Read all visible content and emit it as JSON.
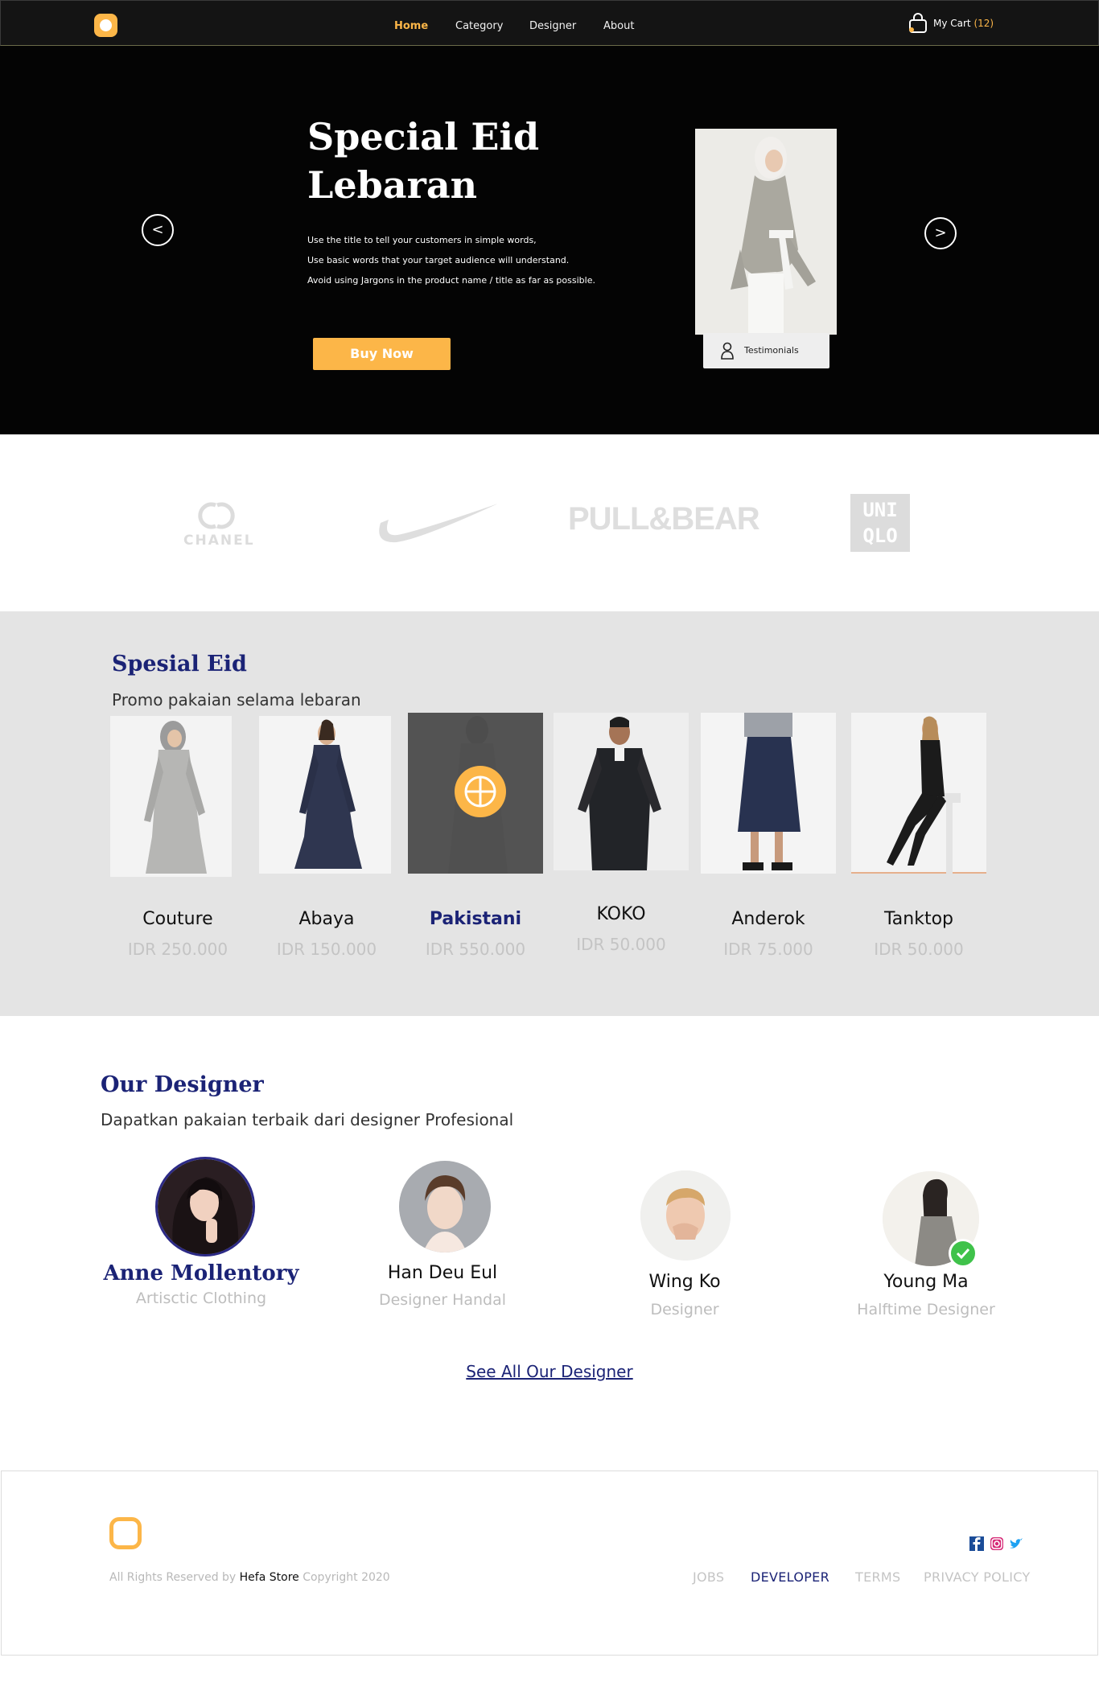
{
  "header": {
    "nav": [
      {
        "label": "Home",
        "active": true
      },
      {
        "label": "Category",
        "active": false
      },
      {
        "label": "Designer",
        "active": false
      },
      {
        "label": "About",
        "active": false
      }
    ],
    "cart_label": "My Cart ",
    "cart_count": "(12)"
  },
  "hero": {
    "title": "Special Eid Lebaran",
    "lines": [
      "Use the title to tell your customers in simple words,",
      "Use basic words that your target audience will understand.",
      "Avoid using Jargons in the product name / title as far as possible."
    ],
    "buy_label": "Buy Now",
    "prev_label": "<",
    "next_label": ">",
    "testimonials_label": "Testimonials"
  },
  "brands": {
    "items": [
      {
        "name": "CHANEL"
      },
      {
        "name": "Nike"
      },
      {
        "name": "PULL&BEAR"
      },
      {
        "name": "UNI QLO",
        "line1": "UNI",
        "line2": "QLO"
      }
    ]
  },
  "eid": {
    "title": "Spesial Eid",
    "subtitle": "Promo pakaian selama lebaran",
    "products": [
      {
        "name": "Couture",
        "price": "IDR 250.000"
      },
      {
        "name": "Abaya",
        "price": "IDR 150.000"
      },
      {
        "name": "Pakistani",
        "price": "IDR 550.000"
      },
      {
        "name": "KOKO",
        "price": "IDR 50.000"
      },
      {
        "name": "Anderok",
        "price": "IDR 75.000"
      },
      {
        "name": "Tanktop",
        "price": "IDR 50.000"
      }
    ]
  },
  "designers": {
    "title": "Our Designer",
    "subtitle": "Dapatkan pakaian terbaik dari designer Profesional",
    "items": [
      {
        "name": "Anne Mollentory",
        "role": "Artisctic Clothing"
      },
      {
        "name": "Han Deu Eul",
        "role": "Designer Handal"
      },
      {
        "name": "Wing Ko",
        "role": "Designer"
      },
      {
        "name": "Young Ma",
        "role": "Halftime Designer"
      }
    ],
    "see_all": "See All Our Designer"
  },
  "footer": {
    "copy_prefix": "All Rights Reserved by ",
    "store": "Hefa Store",
    "copy_suffix": " Copyright 2020",
    "links": [
      "JOBS",
      "DEVELOPER",
      "TERMS",
      "PRIVACY POLICY"
    ]
  },
  "colors": {
    "accent": "#fcb648",
    "brand_navy": "#1b2376",
    "hero_bg": "#040404",
    "section_grey": "#e4e4e4"
  }
}
